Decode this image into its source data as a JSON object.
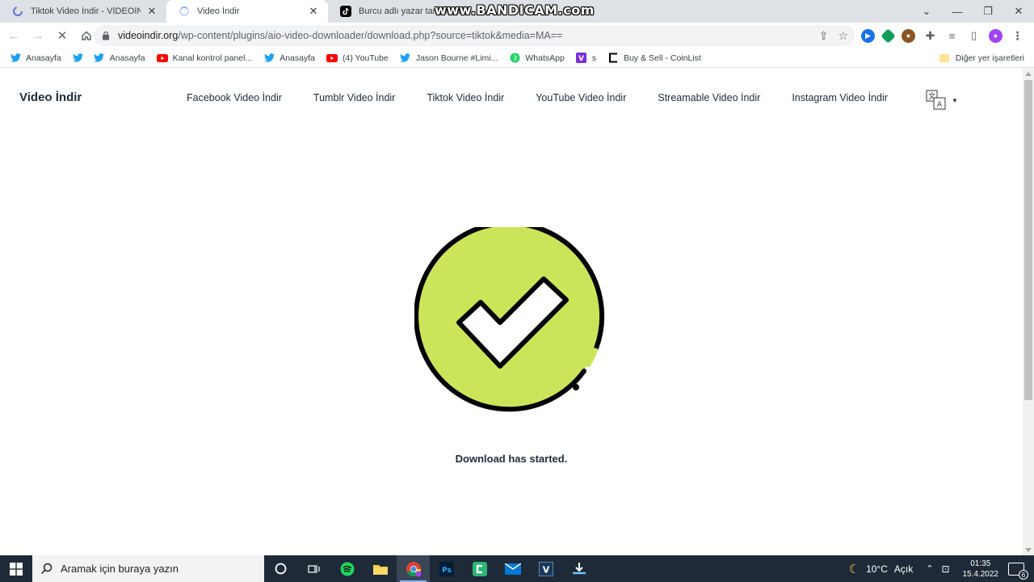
{
  "browser": {
    "tabs": [
      {
        "title": "Tiktok Video İndir - VİDEOİNDİR.",
        "state": "inactive"
      },
      {
        "title": "Video İndir",
        "state": "active-loading"
      },
      {
        "title": "Burcu adlı yazar tarafından",
        "state": "inactive"
      }
    ],
    "watermark": "www.BANDICAM.com",
    "url_host": "videoindir.org",
    "url_path": "/wp-content/plugins/aio-video-downloader/download.php?source=tiktok&media=MA==",
    "bookmarks": [
      {
        "label": "Anasayfa",
        "icon": "twitter-icon"
      },
      {
        "label": "",
        "icon": "twitter-icon"
      },
      {
        "label": "Anasayfa",
        "icon": "twitter-icon"
      },
      {
        "label": "Kanal kontrol panel...",
        "icon": "youtube-icon"
      },
      {
        "label": "Anasayfa",
        "icon": "twitter-icon"
      },
      {
        "label": "(4) YouTube",
        "icon": "youtube-icon"
      },
      {
        "label": "Jason Bourne #Limi...",
        "icon": "twitter-icon"
      },
      {
        "label": "WhatsApp",
        "icon": "whatsapp-icon"
      },
      {
        "label": "s",
        "icon": "viber-icon"
      },
      {
        "label": "Buy & Sell - CoinList",
        "icon": "coinlist-icon"
      }
    ],
    "other_bookmarks": "Diğer yer işaretleri"
  },
  "site": {
    "logo": "Video İndir",
    "nav": [
      "Facebook Video İndir",
      "Tumblr Video İndir",
      "Tiktok Video İndir",
      "YouTube Video İndir",
      "Streamable Video İndir",
      "Instagram Video İndir"
    ],
    "status_message": "Download has started."
  },
  "taskbar": {
    "search_placeholder": "Aramak için buraya yazın",
    "weather_temp": "10°C",
    "weather_desc": "Açık",
    "time": "01:35",
    "date": "15.4.2022",
    "notification_count": "6"
  },
  "colors": {
    "check_fill": "#cbe55a",
    "tab_strip": "#dee1e6",
    "taskbar": "#1f2a38",
    "text_dark": "#1d2b3a"
  }
}
